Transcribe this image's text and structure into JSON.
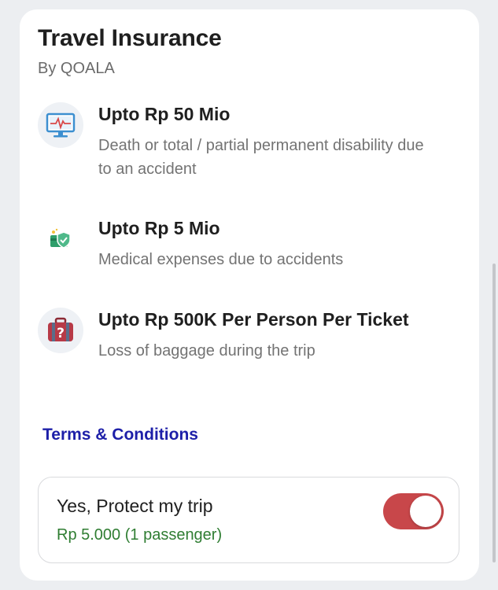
{
  "header": {
    "title": "Travel Insurance",
    "subtitle": "By QOALA"
  },
  "benefits": [
    {
      "icon": "monitor-heartbeat-icon",
      "heading": "Upto Rp 50 Mio",
      "description": "Death or total / partial permanent disability due to an accident"
    },
    {
      "icon": "medical-card-shield-icon",
      "heading": "Upto Rp 5 Mio",
      "description": "Medical expenses due to accidents"
    },
    {
      "icon": "lost-baggage-icon",
      "heading": "Upto Rp 500K Per Person Per Ticket",
      "description": "Loss of baggage during the trip"
    }
  ],
  "terms_link": "Terms & Conditions",
  "protect": {
    "label": "Yes, Protect my trip",
    "price": "Rp 5.000 (1 passenger)",
    "enabled": true
  },
  "colors": {
    "accent_link": "#1d1fa8",
    "toggle_on": "#c8474a",
    "price_green": "#2f7d32"
  }
}
